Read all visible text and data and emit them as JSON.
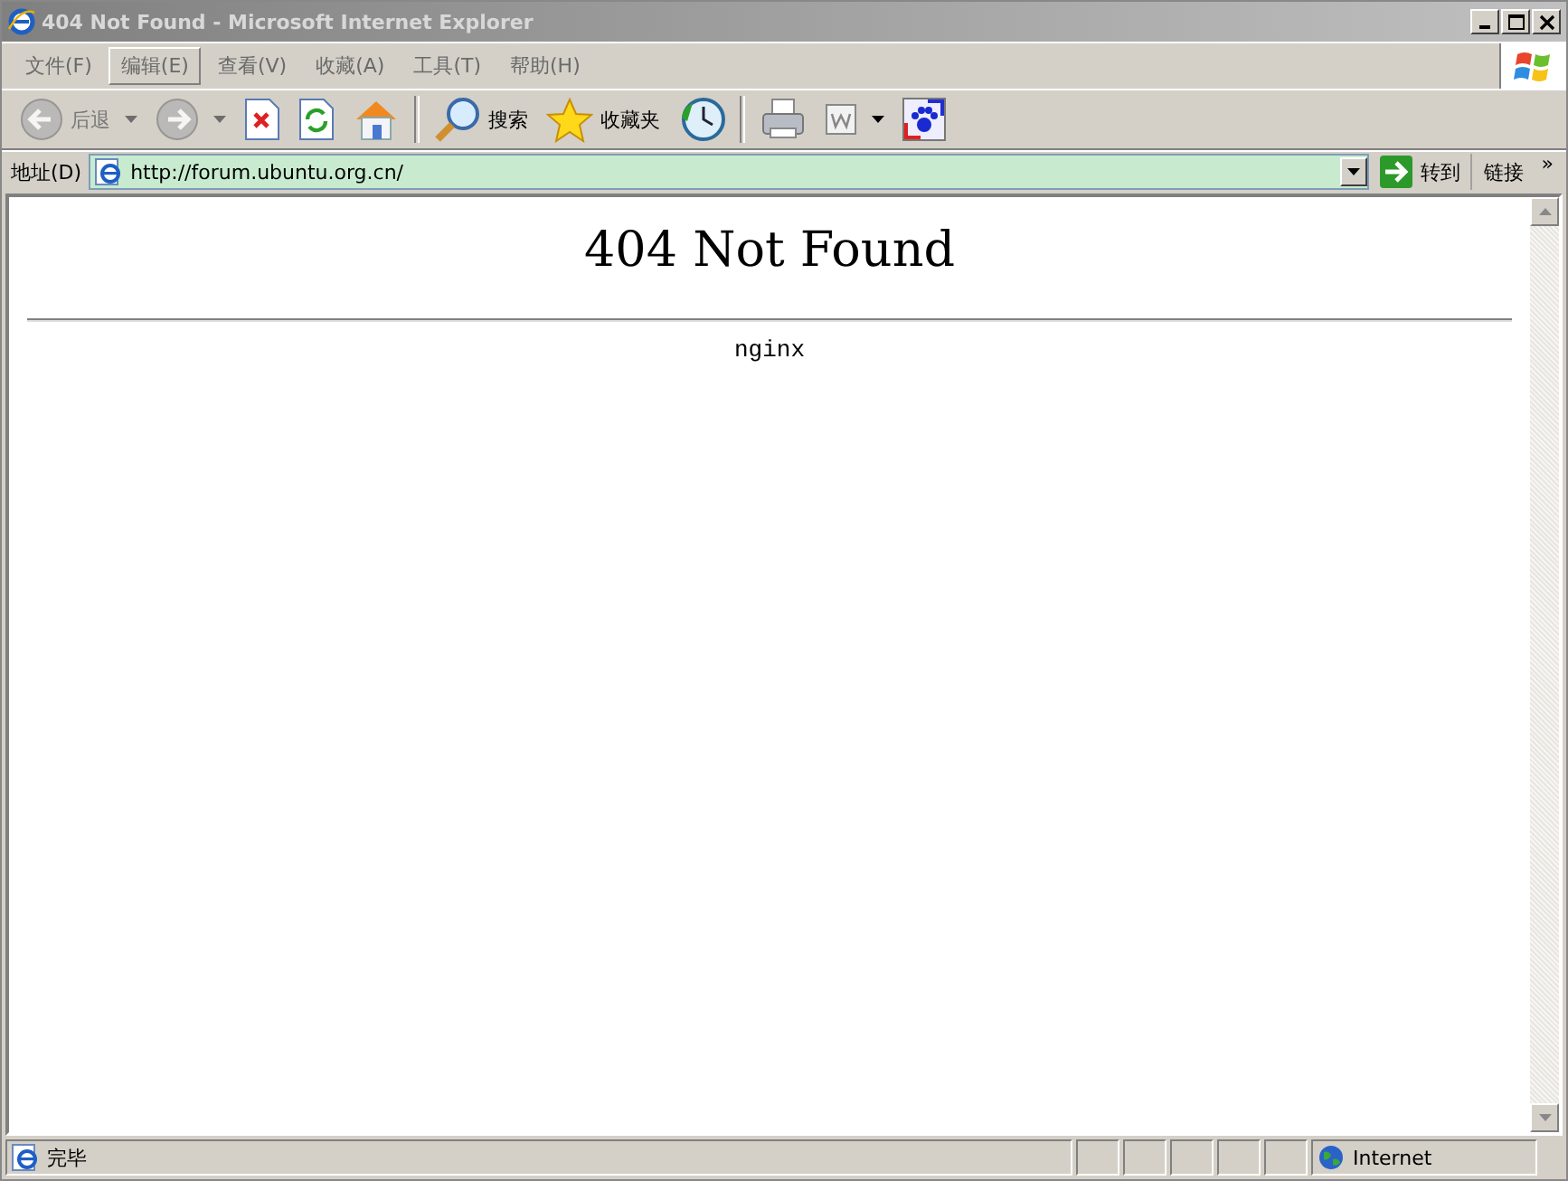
{
  "window": {
    "title": "404 Not Found - Microsoft Internet Explorer",
    "active": false
  },
  "menu": [
    {
      "label": "文件(F)",
      "selected": false
    },
    {
      "label": "编辑(E)",
      "selected": true
    },
    {
      "label": "查看(V)",
      "selected": false
    },
    {
      "label": "收藏(A)",
      "selected": false
    },
    {
      "label": "工具(T)",
      "selected": false
    },
    {
      "label": "帮助(H)",
      "selected": false
    }
  ],
  "toolbar": [
    {
      "kind": "back",
      "label": "后退",
      "disabled": true
    },
    {
      "kind": "forward",
      "disabled": true
    },
    {
      "kind": "stop",
      "disabled": false
    },
    {
      "kind": "refresh",
      "disabled": false
    },
    {
      "kind": "home",
      "disabled": false
    },
    {
      "kind": "separator"
    },
    {
      "kind": "search",
      "label": "搜索",
      "disabled": false
    },
    {
      "kind": "favorites",
      "label": "收藏夹",
      "disabled": false
    },
    {
      "kind": "history",
      "disabled": false
    },
    {
      "kind": "separator"
    },
    {
      "kind": "print",
      "disabled": false
    },
    {
      "kind": "edit",
      "disabled": false
    },
    {
      "kind": "paw",
      "disabled": false
    }
  ],
  "address_bar": {
    "label": "地址(D)",
    "value": "http://forum.ubuntu.org.cn/",
    "go": "转到",
    "links": "链接",
    "more": "»"
  },
  "page": {
    "heading": "404 Not Found",
    "server": "nginx"
  },
  "status_bar": {
    "text": "完毕",
    "zone": "Internet"
  }
}
